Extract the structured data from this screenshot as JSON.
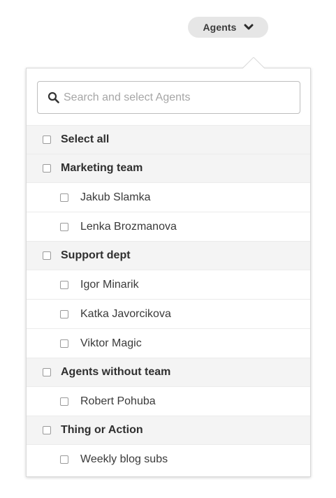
{
  "trigger": {
    "label": "Agents"
  },
  "search": {
    "placeholder": "Search and select Agents",
    "value": ""
  },
  "list": {
    "select_all": "Select all",
    "groups": [
      {
        "label": "Marketing team",
        "items": [
          "Jakub Slamka",
          "Lenka Brozmanova"
        ]
      },
      {
        "label": "Support dept",
        "items": [
          "Igor Minarik",
          "Katka Javorcikova",
          "Viktor Magic"
        ]
      },
      {
        "label": "Agents without team",
        "items": [
          "Robert Pohuba"
        ]
      },
      {
        "label": "Thing or Action",
        "items": [
          "Weekly blog subs"
        ]
      }
    ]
  },
  "colors": {
    "trigger_bg": "#e6e6e6",
    "group_row_bg": "#f4f4f4",
    "border": "#d9d9d9",
    "placeholder": "#a6a6a6"
  },
  "icons": {
    "trigger": "chevron-down-icon",
    "search": "search-icon",
    "checkbox": "checkbox-unchecked-icon"
  }
}
